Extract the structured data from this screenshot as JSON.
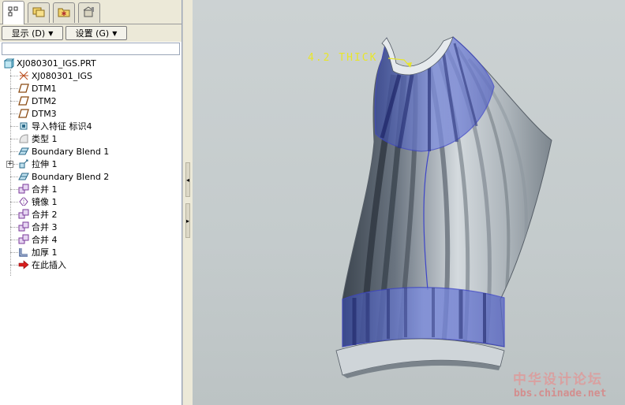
{
  "tabs": [
    {
      "icon": "model-tree-icon"
    },
    {
      "icon": "folder-browser-icon"
    },
    {
      "icon": "favorites-icon"
    },
    {
      "icon": "connections-icon"
    }
  ],
  "toolbar": {
    "display_label": "显示 (D)",
    "settings_label": "设置 (G)"
  },
  "tree": {
    "root": "XJ080301_IGS.PRT",
    "items": [
      {
        "label": "XJ080301_IGS",
        "icon": "coordinate-system-icon"
      },
      {
        "label": "DTM1",
        "icon": "datum-plane-icon"
      },
      {
        "label": "DTM2",
        "icon": "datum-plane-icon"
      },
      {
        "label": "DTM3",
        "icon": "datum-plane-icon"
      },
      {
        "label": "导入特征 标识4",
        "icon": "import-feature-icon"
      },
      {
        "label": "类型 1",
        "icon": "type-feature-icon"
      },
      {
        "label": "Boundary Blend 1",
        "icon": "boundary-blend-icon"
      },
      {
        "label": "拉伸 1",
        "icon": "extrude-icon"
      },
      {
        "label": "Boundary Blend 2",
        "icon": "boundary-blend-icon"
      },
      {
        "label": "合并 1",
        "icon": "merge-icon"
      },
      {
        "label": "镜像 1",
        "icon": "mirror-icon"
      },
      {
        "label": "合并 2",
        "icon": "merge-icon"
      },
      {
        "label": "合并 3",
        "icon": "merge-icon"
      },
      {
        "label": "合并 4",
        "icon": "merge-icon"
      },
      {
        "label": "加厚 1",
        "icon": "thicken-icon"
      },
      {
        "label": "在此插入",
        "icon": "insert-here-arrow-icon"
      }
    ]
  },
  "viewport": {
    "annotation": "4.2 THICK",
    "annotation_color": "#e8e62a",
    "surface_highlight_color": "#5a6fd6"
  },
  "watermark": {
    "site_name": "中华设计论坛",
    "url": "bbs.chinade.net"
  }
}
